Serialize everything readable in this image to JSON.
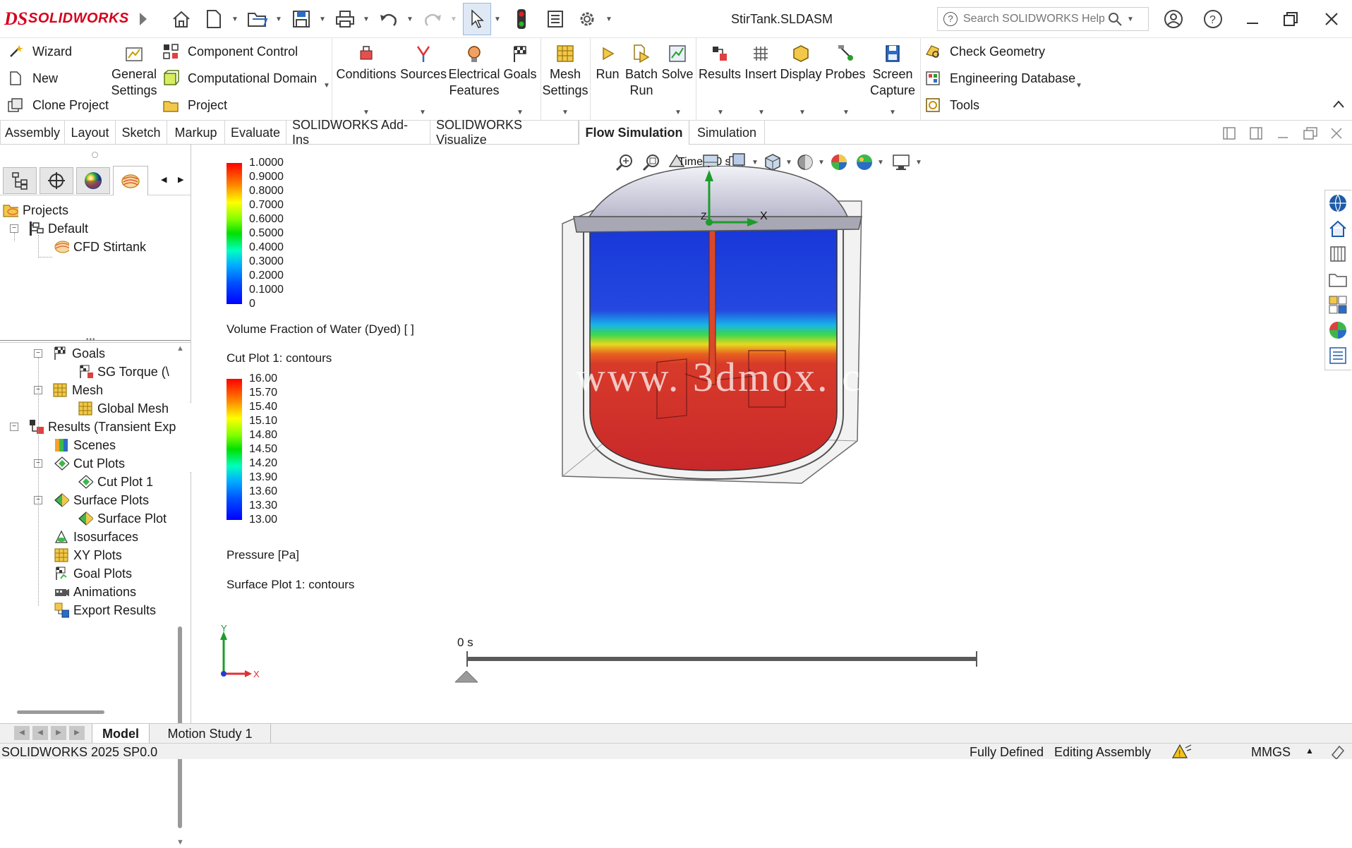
{
  "app": {
    "brand": "SOLIDWORKS",
    "document_title": "StirTank.SLDASM",
    "search_placeholder": "Search SOLIDWORKS Help",
    "accent_red": "#d6001c"
  },
  "ribbon": {
    "left_group": [
      "Wizard",
      "New",
      "Clone Project"
    ],
    "general_settings": [
      "General",
      "Settings"
    ],
    "component_group": [
      "Component Control",
      "Computational Domain",
      "Project"
    ],
    "buttons": [
      {
        "id": "conditions",
        "lines": [
          "Conditions"
        ]
      },
      {
        "id": "sources",
        "lines": [
          "Sources"
        ]
      },
      {
        "id": "electrical",
        "lines": [
          "Electrical",
          "Features"
        ]
      },
      {
        "id": "goals",
        "lines": [
          "Goals"
        ]
      },
      {
        "id": "mesh",
        "lines": [
          "Mesh",
          "Settings"
        ]
      },
      {
        "id": "run",
        "lines": [
          "Run"
        ]
      },
      {
        "id": "batch",
        "lines": [
          "Batch",
          "Run"
        ]
      },
      {
        "id": "solve",
        "lines": [
          "Solve"
        ]
      },
      {
        "id": "results",
        "lines": [
          "Results"
        ]
      },
      {
        "id": "insert",
        "lines": [
          "Insert"
        ]
      },
      {
        "id": "display",
        "lines": [
          "Display"
        ]
      },
      {
        "id": "probes",
        "lines": [
          "Probes"
        ]
      },
      {
        "id": "screen",
        "lines": [
          "Screen",
          "Capture"
        ]
      }
    ],
    "right_group": [
      "Check Geometry",
      "Engineering Database",
      "Tools"
    ]
  },
  "tabs": [
    "Assembly",
    "Layout",
    "Sketch",
    "Markup",
    "Evaluate",
    "SOLIDWORKS Add-Ins",
    "SOLIDWORKS Visualize",
    "Flow Simulation",
    "Simulation"
  ],
  "active_tab": "Flow Simulation",
  "tree_top": {
    "projects": "Projects",
    "default": "Default",
    "cfd": "CFD Stirtank"
  },
  "tree_bottom": [
    {
      "label": "Goals",
      "level": 1
    },
    {
      "label": "SG Torque (\\",
      "level": 2
    },
    {
      "label": "Mesh",
      "level": 1
    },
    {
      "label": "Global Mesh",
      "level": 2
    },
    {
      "label": "Results (Transient Exp",
      "level": 0
    },
    {
      "label": "Scenes",
      "level": 1
    },
    {
      "label": "Cut Plots",
      "level": 1
    },
    {
      "label": "Cut Plot 1",
      "level": 2
    },
    {
      "label": "Surface Plots",
      "level": 1
    },
    {
      "label": "Surface Plot",
      "level": 2
    },
    {
      "label": "Isosurfaces",
      "level": 1
    },
    {
      "label": "XY Plots",
      "level": 1
    },
    {
      "label": "Goal Plots",
      "level": 1
    },
    {
      "label": "Animations",
      "level": 1
    },
    {
      "label": "Export Results",
      "level": 1
    }
  ],
  "legend1": {
    "values": [
      "1.0000",
      "0.9000",
      "0.8000",
      "0.7000",
      "0.6000",
      "0.5000",
      "0.4000",
      "0.3000",
      "0.2000",
      "0.1000",
      "0"
    ],
    "parameter": "Volume Fraction of Water (Dyed) [ ]",
    "plot": "Cut Plot 1: contours"
  },
  "legend2": {
    "values": [
      "16.00",
      "15.70",
      "15.40",
      "15.10",
      "14.80",
      "14.50",
      "14.20",
      "13.90",
      "13.60",
      "13.30",
      "13.00"
    ],
    "parameter": "Pressure [Pa]",
    "plot": "Surface Plot 1: contours"
  },
  "viewport": {
    "time_label": "Time = 0 s",
    "watermark": "www. 3dmox. com",
    "axis_y": "Y",
    "axis_x": "X",
    "axis_z": "Z",
    "timeline_label": "0 s",
    "timeline_position": 0.0
  },
  "bottom_tabs": [
    "Model",
    "Motion Study 1"
  ],
  "status": {
    "version": "SOLIDWORKS 2025 SP0.0",
    "defined": "Fully Defined",
    "mode": "Editing Assembly",
    "units": "MMGS"
  }
}
